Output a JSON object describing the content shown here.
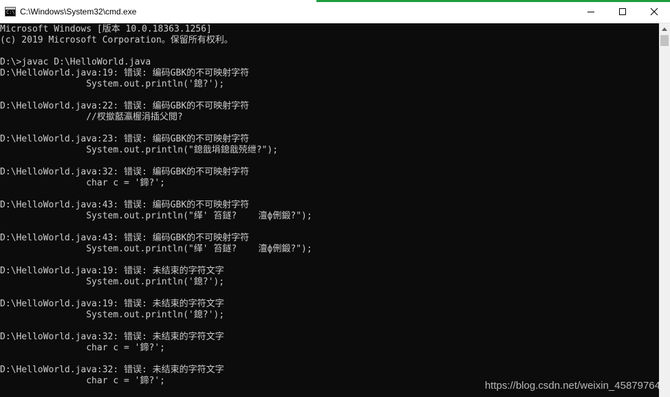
{
  "window": {
    "title": "C:\\Windows\\System32\\cmd.exe",
    "icon": "cmd-icon",
    "icon_text": "C:\\",
    "accent_color": "#1e9e3e"
  },
  "controls": {
    "minimize": "minimize-icon",
    "maximize": "maximize-icon",
    "close": "close-icon"
  },
  "console": {
    "background": "#0c0c0c",
    "text_color": "#cccccc",
    "lines": [
      "Microsoft Windows [版本 10.0.18363.1256]",
      "(c) 2019 Microsoft Corporation。保留所有权利。",
      "",
      "D:\\>javac D:\\HelloWorld.java",
      "D:\\HelloWorld.java:19: 错误: 编码GBK的不可映射字符",
      "                System.out.println('鎴?');",
      "",
      "D:\\HelloWorld.java:22: 错误: 编码GBK的不可映射字符",
      "                //杈撳嚭瀛楃涓插父閲?",
      "",
      "D:\\HelloWorld.java:23: 错误: 编码GBK的不可映射字符",
      "                System.out.println(\"鎴戠埍鎴戠殑绁?\");",
      "",
      "D:\\HelloWorld.java:32: 错误: 编码GBK的不可映射字符",
      "                char c = '鍗?';",
      "",
      "D:\\HelloWorld.java:43: 错误: 编码GBK的不可映射字符",
      "                System.out.println(\"缂' 笞鐩?    澶ф侀鍛?\");",
      "",
      "D:\\HelloWorld.java:43: 错误: 编码GBK的不可映射字符",
      "                System.out.println(\"缂' 笞鐩?    澶ф侀鍛?\");",
      "",
      "D:\\HelloWorld.java:19: 错误: 未结束的字符文字",
      "                System.out.println('鎴?');",
      "",
      "D:\\HelloWorld.java:19: 错误: 未结束的字符文字",
      "                System.out.println('鎴?');",
      "",
      "D:\\HelloWorld.java:32: 错误: 未结束的字符文字",
      "                char c = '鍗?';",
      "",
      "D:\\HelloWorld.java:32: 错误: 未结束的字符文字",
      "                char c = '鍗?';"
    ]
  },
  "scrollbar": {
    "up_icon": "scroll-up-arrow-icon"
  },
  "watermark": "https://blog.csdn.net/weixin_45879764"
}
